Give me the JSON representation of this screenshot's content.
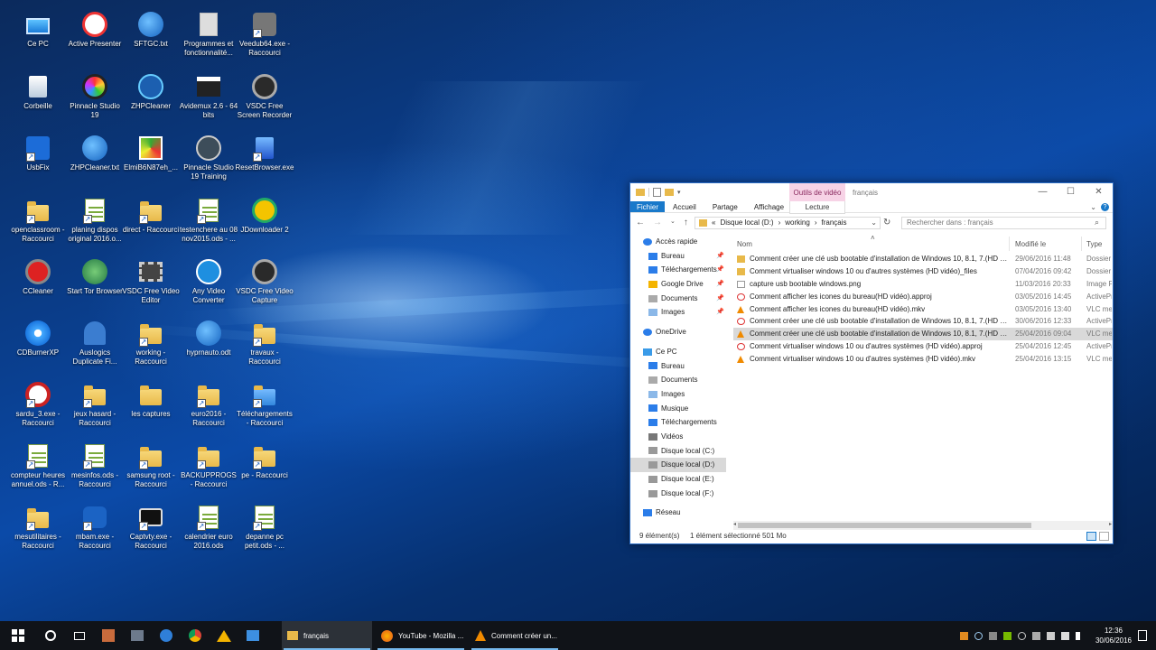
{
  "desktop_icons": [
    {
      "label": "Ce PC",
      "icon": "computer-icon"
    },
    {
      "label": "Active Presenter",
      "icon": "active-presenter-icon"
    },
    {
      "label": "SFTGC.txt",
      "icon": "text-file-icon"
    },
    {
      "label": "Programmes et fonctionnalité...",
      "icon": "programs-icon"
    },
    {
      "label": "Veedub64.exe - Raccourci",
      "icon": "gear-app-icon"
    },
    {
      "label": "Corbeille",
      "icon": "recycle-bin-icon"
    },
    {
      "label": "Pinnacle Studio 19",
      "icon": "pinnacle-icon"
    },
    {
      "label": "ZHPCleaner",
      "icon": "zhp-icon"
    },
    {
      "label": "Avidemux 2.6 - 64 bits",
      "icon": "clapper-icon"
    },
    {
      "label": "VSDC Free Screen Recorder",
      "icon": "camera-icon"
    },
    {
      "label": "UsbFix",
      "icon": "usbfix-icon"
    },
    {
      "label": "ZHPCleaner.txt",
      "icon": "text-file-icon"
    },
    {
      "label": "ElmiB6N87eh_...",
      "icon": "image-file-icon"
    },
    {
      "label": "Pinnacle Studio 19 Training",
      "icon": "sb-icon"
    },
    {
      "label": "ResetBrowser.exe",
      "icon": "recycle-app-icon"
    },
    {
      "label": "openclassroom - Raccourci",
      "icon": "folder-shortcut-icon"
    },
    {
      "label": "planing dispos original 2016.o...",
      "icon": "spreadsheet-icon"
    },
    {
      "label": "direct - Raccourci",
      "icon": "folder-shortcut-icon"
    },
    {
      "label": "testenchere au 08 nov2015.ods - ...",
      "icon": "spreadsheet-icon"
    },
    {
      "label": "JDownloader 2",
      "icon": "jdownloader-icon"
    },
    {
      "label": "CCleaner",
      "icon": "ccleaner-icon"
    },
    {
      "label": "Start Tor Browser",
      "icon": "tor-globe-icon"
    },
    {
      "label": "VSDC Free Video Editor",
      "icon": "film-icon"
    },
    {
      "label": "Any Video Converter",
      "icon": "converter-icon"
    },
    {
      "label": "VSDC Free Video Capture",
      "icon": "camera-icon"
    },
    {
      "label": "CDBurnerXP",
      "icon": "cdburner-icon"
    },
    {
      "label": "Auslogics Duplicate Fi...",
      "icon": "auslogics-icon"
    },
    {
      "label": "working - Raccourci",
      "icon": "folder-shortcut-icon"
    },
    {
      "label": "hyprnauto.odt",
      "icon": "text-file-icon"
    },
    {
      "label": "travaux - Raccourci",
      "icon": "folder-shortcut-icon"
    },
    {
      "label": "sardu_3.exe - Raccourci",
      "icon": "sardu-icon"
    },
    {
      "label": "jeux hasard - Raccourci",
      "icon": "folder-shortcut-icon"
    },
    {
      "label": "les captures",
      "icon": "folder-icon"
    },
    {
      "label": "euro2016 - Raccourci",
      "icon": "folder-shortcut-icon"
    },
    {
      "label": "Téléchargements - Raccourci",
      "icon": "download-folder-icon"
    },
    {
      "label": "compteur heures annuel.ods - R...",
      "icon": "spreadsheet-icon"
    },
    {
      "label": "mesinfos.ods - Raccourci",
      "icon": "spreadsheet-icon"
    },
    {
      "label": "samsung root - Raccourci",
      "icon": "folder-shortcut-icon"
    },
    {
      "label": "BACKUPPROGS - Raccourci",
      "icon": "folder-shortcut-icon"
    },
    {
      "label": "pe - Raccourci",
      "icon": "folder-shortcut-icon"
    },
    {
      "label": "mesutilitaires - Raccourci",
      "icon": "folder-shortcut-icon"
    },
    {
      "label": "mbam.exe - Raccourci",
      "icon": "malwarebytes-icon"
    },
    {
      "label": "Captvty.exe - Raccourci",
      "icon": "monitor-icon"
    },
    {
      "label": "calendrier euro 2016.ods",
      "icon": "spreadsheet-icon"
    },
    {
      "label": "depanne pc petit.ods - ...",
      "icon": "spreadsheet-icon"
    }
  ],
  "explorer": {
    "context_tab": "Outils de vidéo",
    "window_title": "français",
    "ribbon_tabs": [
      "Fichier",
      "Accueil",
      "Partage",
      "Affichage"
    ],
    "context_subtab": "Lecture",
    "address": [
      "«",
      "Disque local (D:)",
      "›",
      "working",
      "›",
      "français"
    ],
    "search_placeholder": "Rechercher dans : français",
    "nav": [
      {
        "label": "Accès rapide",
        "pin": false,
        "indent": false,
        "icon": "star-icon"
      },
      {
        "label": "Bureau",
        "pin": true,
        "indent": true,
        "icon": "desktop-icon"
      },
      {
        "label": "Téléchargements",
        "pin": true,
        "indent": true,
        "icon": "download-icon"
      },
      {
        "label": "Google Drive",
        "pin": true,
        "indent": true,
        "icon": "google-drive-icon"
      },
      {
        "label": "Documents",
        "pin": true,
        "indent": true,
        "icon": "documents-icon"
      },
      {
        "label": "Images",
        "pin": true,
        "indent": true,
        "icon": "images-icon"
      },
      {
        "label": "",
        "spacer": true
      },
      {
        "label": "OneDrive",
        "pin": false,
        "indent": false,
        "icon": "cloud-icon"
      },
      {
        "label": "",
        "spacer": true
      },
      {
        "label": "Ce PC",
        "pin": false,
        "indent": false,
        "icon": "computer-icon"
      },
      {
        "label": "Bureau",
        "pin": false,
        "indent": true,
        "icon": "desktop-icon"
      },
      {
        "label": "Documents",
        "pin": false,
        "indent": true,
        "icon": "documents-icon"
      },
      {
        "label": "Images",
        "pin": false,
        "indent": true,
        "icon": "images-icon"
      },
      {
        "label": "Musique",
        "pin": false,
        "indent": true,
        "icon": "music-icon"
      },
      {
        "label": "Téléchargements",
        "pin": false,
        "indent": true,
        "icon": "download-icon"
      },
      {
        "label": "Vidéos",
        "pin": false,
        "indent": true,
        "icon": "video-icon"
      },
      {
        "label": "Disque local (C:)",
        "pin": false,
        "indent": true,
        "icon": "drive-icon"
      },
      {
        "label": "Disque local (D:)",
        "pin": false,
        "indent": true,
        "icon": "drive-icon",
        "selected": true
      },
      {
        "label": "Disque local (E:)",
        "pin": false,
        "indent": true,
        "icon": "drive-icon"
      },
      {
        "label": "Disque local (F:)",
        "pin": false,
        "indent": true,
        "icon": "drive-icon"
      },
      {
        "label": "",
        "spacer": true
      },
      {
        "label": "Réseau",
        "pin": false,
        "indent": false,
        "icon": "network-icon"
      }
    ],
    "columns": {
      "name": "Nom",
      "date": "Modifié le",
      "type": "Type"
    },
    "files": [
      {
        "name": "Comment créer une clé usb bootable d'installation de Windows 10, 8.1, 7.(HD vid...",
        "date": "29/06/2016 11:48",
        "type": "Dossier d",
        "icon": "folder"
      },
      {
        "name": "Comment virtualiser windows 10 ou d'autres systèmes (HD vidéo)_files",
        "date": "07/04/2016 09:42",
        "type": "Dossier d",
        "icon": "folder"
      },
      {
        "name": "capture usb bootable windows.png",
        "date": "11/03/2016 20:33",
        "type": "Image PN",
        "icon": "image"
      },
      {
        "name": "Comment afficher les icones du bureau(HD vidéo).approj",
        "date": "03/05/2016 14:45",
        "type": "ActivePre",
        "icon": "approj"
      },
      {
        "name": "Comment afficher les icones du bureau(HD vidéo).mkv",
        "date": "03/05/2016 13:40",
        "type": "VLC med",
        "icon": "vlc"
      },
      {
        "name": "Comment créer une clé usb bootable d'installation de Windows 10, 8.1, 7.(HD vid...",
        "date": "30/06/2016 12:33",
        "type": "ActivePre",
        "icon": "approj"
      },
      {
        "name": "Comment créer une clé usb bootable d'installation de Windows 10, 8.1, 7.(HD vid...",
        "date": "25/04/2016 09:04",
        "type": "VLC med",
        "icon": "vlc",
        "selected": true
      },
      {
        "name": "Comment virtualiser windows 10 ou d'autres systèmes (HD vidéo).approj",
        "date": "25/04/2016 12:45",
        "type": "ActivePre",
        "icon": "approj"
      },
      {
        "name": "Comment virtualiser windows 10 ou d'autres systèmes (HD vidéo).mkv",
        "date": "25/04/2016 13:15",
        "type": "VLC med",
        "icon": "vlc"
      }
    ],
    "status_count": "9 élément(s)",
    "status_selection": "1 élément sélectionné  501 Mo"
  },
  "taskbar": {
    "windows": [
      {
        "label": "français",
        "icon": "folder-icon",
        "active": true
      },
      {
        "label": "YouTube - Mozilla ...",
        "icon": "firefox-icon",
        "active": false
      },
      {
        "label": "Comment créer un...",
        "icon": "vlc-icon",
        "active": false
      }
    ],
    "time": "12:36",
    "date": "30/06/2016"
  }
}
